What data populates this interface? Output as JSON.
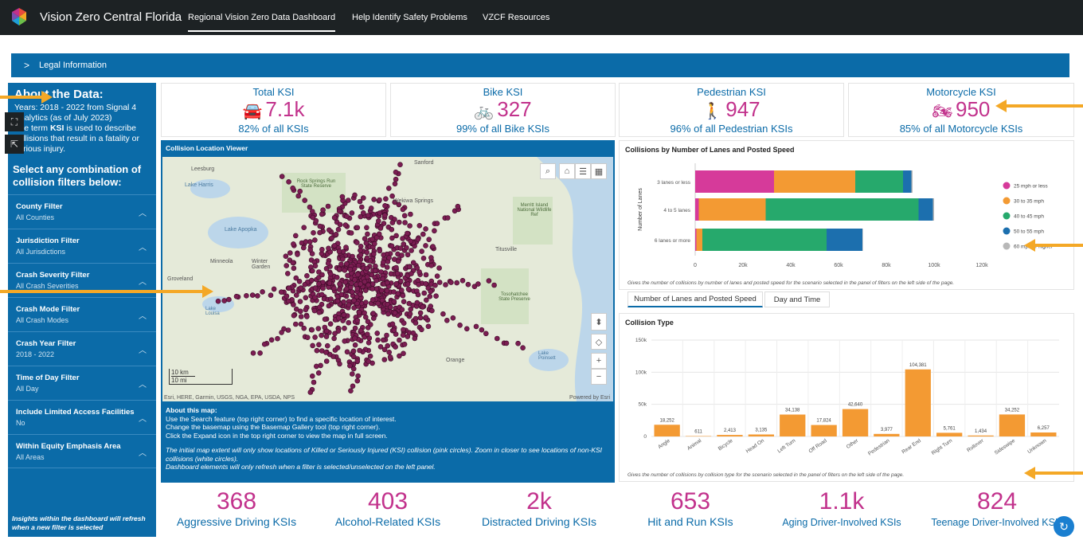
{
  "header": {
    "app_title": "Vision Zero Central Florida",
    "nav": [
      "Regional Vision Zero Data Dashboard",
      "Help Identify Safety Problems",
      "VZCF Resources"
    ]
  },
  "legal": {
    "label": "Legal Information"
  },
  "sidebar": {
    "about_heading": "About the Data:",
    "about_line1": "Years: 2018 - 2022 from Signal 4",
    "about_line2": "Analytics (as of July 2023)",
    "about_line3a": "The term ",
    "about_line3b": "KSI",
    "about_line3c": " is used to describe",
    "about_line4": "collisions that result in a fatality or",
    "about_line5": "serious injury.",
    "select_heading": "Select any combination of collision filters below:",
    "filters": [
      {
        "name": "County Filter",
        "value": "All Counties"
      },
      {
        "name": "Jurisdiction Filter",
        "value": "All Jurisdictions"
      },
      {
        "name": "Crash Severity Filter",
        "value": "All Crash Severities"
      },
      {
        "name": "Crash Mode Filter",
        "value": "All Crash Modes"
      },
      {
        "name": "Crash Year Filter",
        "value": "2018 - 2022"
      },
      {
        "name": "Time of Day Filter",
        "value": "All Day"
      },
      {
        "name": "Include Limited Access Facilities",
        "value": "No"
      },
      {
        "name": "Within Equity Emphasis Area",
        "value": "All Areas"
      }
    ],
    "insight": "Insights within the dashboard will refresh when a new filter is selected"
  },
  "kpis": [
    {
      "title": "Total KSI",
      "icon": "car-icon",
      "glyph": "🚘",
      "value": "7.1k",
      "sub": "82% of all KSIs"
    },
    {
      "title": "Bike KSI",
      "icon": "bicycle-icon",
      "glyph": "🚲",
      "value": "327",
      "sub": "99% of all Bike KSIs"
    },
    {
      "title": "Pedestrian KSI",
      "icon": "pedestrian-icon",
      "glyph": "🚶",
      "value": "947",
      "sub": "96% of all Pedestrian KSIs"
    },
    {
      "title": "Motorcycle KSI",
      "icon": "motorcycle-icon",
      "glyph": "🏍",
      "value": "950",
      "sub": "85% of all Motorcycle KSIs"
    }
  ],
  "map": {
    "title": "Collision Location Viewer",
    "attribution": "Esri, HERE, Garmin, USGS, NGA, EPA, USDA, NPS",
    "powered": "Powered by Esri",
    "scale_km": "10 km",
    "scale_mi": "10 mi",
    "places": [
      "Leesburg",
      "Sanford",
      "Lake Harris",
      "Rock Springs Run State Reserve",
      "Wekiwa Springs",
      "Merritt Island National Wildlife Ref",
      "Lake Apopka",
      "Titusville",
      "Minneola",
      "Winter Garden",
      "Groveland",
      "Tosohatchee State Preserve",
      "Orange",
      "Lake Poinsett",
      "Lake Louisa"
    ],
    "about_heading": "About this map:",
    "about_lines": [
      "Use the Search feature (top right corner) to find a specific location of interest.",
      "Change the basemap using the Basemap Gallery tool (top right corner).",
      "Click the Expand icon in the top right corner to view the map in full screen."
    ],
    "note1": "The initial map extent will only show locations of Killed or Seriously Injured (KSI) collision (pink circles). Zoom in closer to see locations of non-KSI collisions (white circles).",
    "note2": "Dashboard elements will only refresh when a filter is selected/unselected on the left panel.",
    "point_color": "#7b1d52"
  },
  "chart_lanes": {
    "title": "Collisions by Number of Lanes and Posted Speed",
    "note": "Gives the number of collisions by number of lanes and posted speed for the scenario selected in the panel of filters on the left side of the page.",
    "ylabel": "Number of Lanes",
    "xticks": [
      "0",
      "20k",
      "40k",
      "60k",
      "80k",
      "100k",
      "120k"
    ]
  },
  "chart_data": [
    {
      "type": "bar",
      "orientation": "horizontal-stacked",
      "title": "Collisions by Number of Lanes and Posted Speed",
      "ylabel": "Number of Lanes",
      "xlim": [
        0,
        120000
      ],
      "categories": [
        "3 lanes or less",
        "4 to 5 lanes",
        "6 lanes or more"
      ],
      "series": [
        {
          "name": "25 mph or less",
          "color": "#d63a9a",
          "values": [
            33000,
            1500,
            500
          ]
        },
        {
          "name": "30 to 35 mph",
          "color": "#f39a33",
          "values": [
            34000,
            28000,
            2500
          ]
        },
        {
          "name": "40 to 45 mph",
          "color": "#26a96c",
          "values": [
            20000,
            64000,
            52000
          ]
        },
        {
          "name": "50 to 55 mph",
          "color": "#1c6fae",
          "values": [
            3500,
            6000,
            15000
          ]
        },
        {
          "name": "60 mph or higher",
          "color": "#b8b8b8",
          "values": [
            500,
            500,
            200
          ]
        }
      ],
      "legend": "right"
    },
    {
      "type": "bar",
      "title": "Collision Type",
      "ylim": [
        0,
        150000
      ],
      "yticks": [
        "0",
        "50k",
        "100k",
        "150k"
      ],
      "categories": [
        "Angle",
        "Animal",
        "Bicycle",
        "Head On",
        "Left Turn",
        "Off Road",
        "Other",
        "Pedestrian",
        "Rear End",
        "Right Turn",
        "Rollover",
        "Sideswipe",
        "Unknown"
      ],
      "values": [
        18252,
        611,
        2413,
        3135,
        34138,
        17824,
        42640,
        3977,
        104381,
        5761,
        1434,
        34252,
        6257
      ],
      "labels": [
        "18,252",
        "611",
        "2,413",
        "3,135",
        "34,138",
        "17,824",
        "42,640",
        "3,977",
        "104,381",
        "5,761",
        "1,434",
        "34,252",
        "6,257"
      ],
      "color": "#f39a33",
      "note": "Gives the number of collisions by collision type for the scenario selected in the panel of filters on the left side of the page."
    }
  ],
  "tabs": [
    "Number of Lanes and Posted Speed",
    "Day and Time"
  ],
  "bottom": [
    {
      "value": "368",
      "label": "Aggressive Driving KSIs"
    },
    {
      "value": "403",
      "label": "Alcohol-Related KSIs"
    },
    {
      "value": "2k",
      "label": "Distracted Driving KSIs"
    },
    {
      "value": "653",
      "label": "Hit and Run KSIs"
    },
    {
      "value": "1.1k",
      "label": "Aging Driver-Involved KSIs"
    },
    {
      "value": "824",
      "label": "Teenage Driver-Involved KSIs"
    }
  ],
  "colors": {
    "brand": "#0b6ba8",
    "accent": "#c2328c",
    "arrow": "#f4a826",
    "header": "#1d2224"
  }
}
